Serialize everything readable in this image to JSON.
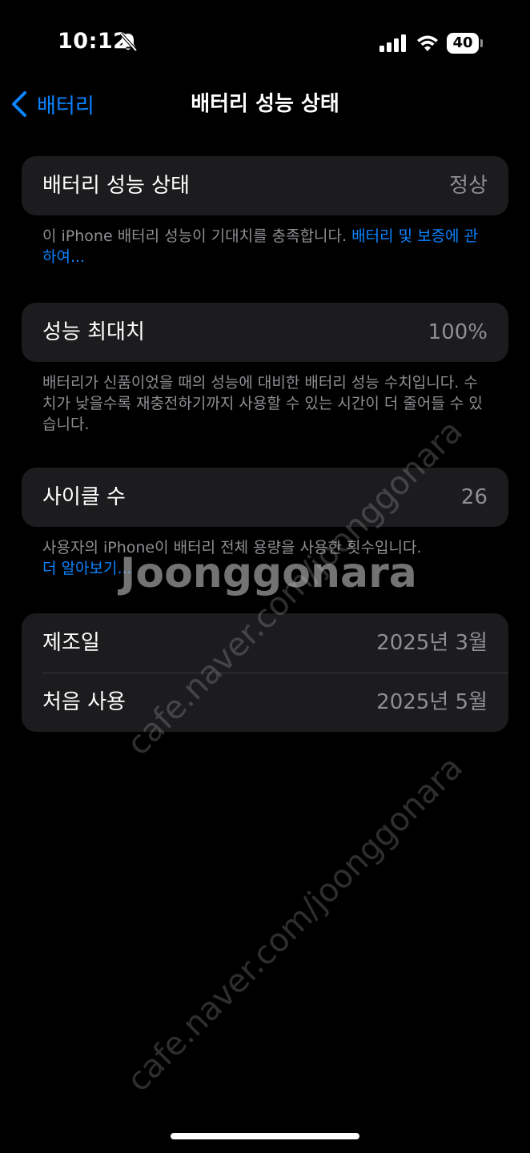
{
  "status_bar": {
    "time": "10:12",
    "battery_level": "40",
    "icons": [
      "bell-slash-icon",
      "cellular-signal-icon",
      "wifi-icon",
      "battery-icon"
    ]
  },
  "nav": {
    "back_label": "배터리",
    "title": "배터리 성능 상태",
    "back_icon": "chevron-left-icon"
  },
  "health": {
    "label": "배터리 성능 상태",
    "value": "정상",
    "footer_text": "이 iPhone 배터리 성능이 기대치를 충족합니다. ",
    "footer_link": "배터리 및 보증에 관하여..."
  },
  "capacity": {
    "label": "성능 최대치",
    "value": "100%",
    "footer_text": "배터리가 신품이었을 때의 성능에 대비한 배터리 성능 수치입니다. 수치가 낮을수록 재충전하기까지 사용할 수 있는 시간이 더 줄어들 수 있습니다."
  },
  "cycle": {
    "label": "사이클 수",
    "value": "26",
    "footer_text": "사용자의 iPhone이 배터리 전체 용량을 사용한 횟수입니다.",
    "footer_link": "더 알아보기..."
  },
  "dates": {
    "manufacture_label": "제조일",
    "manufacture_value": "2025년 3월",
    "first_use_label": "처음 사용",
    "first_use_value": "2025년 5월"
  },
  "watermark": {
    "site": "cafe.naver.com/joonggonara",
    "brand": "Joonggonara"
  },
  "colors": {
    "background": "#000000",
    "card": "#1c1c1e",
    "accent": "#0a84ff",
    "secondary_text": "#8e8e93"
  }
}
